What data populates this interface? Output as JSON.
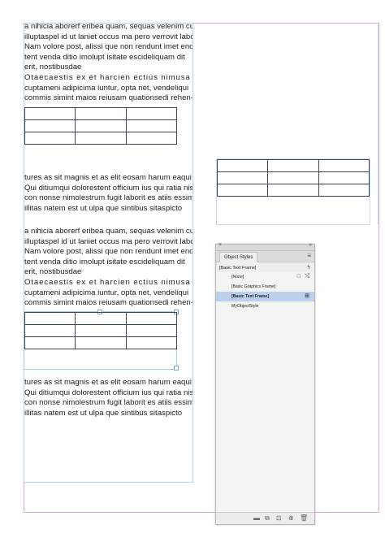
{
  "body_text": {
    "para1_lines": [
      "a nihicia aborerf eribea quam, sequas velenim cum",
      "illuptaspel id ut laniet occus ma pero verrovit labo.",
      "Nam volore post, alissi que non rendunt imet endio",
      "tent venda ditio imolupt isitate escideliquam dit",
      "erit, nostibusdae"
    ],
    "para2_lines": [
      "Otaecaestis ex et harcien ectius nimusa qui",
      "cuptameni adipicima iuntur, opta net, vendeliqui",
      "commis simint maios reiusam quationsedi rehen-"
    ],
    "para3_lines": [
      "tures as sit magnis et as elit eosam harum eaqui",
      "Qui ditiumqui dolorestent officium ius qui ratia nis",
      "con nonse nimolestrum fugit laborit es atiis essim",
      "illitas natem est ut ulpa que sintibus sitaspicto"
    ]
  },
  "tables": {
    "rows": 3,
    "cols": 3
  },
  "object_styles_panel": {
    "close_glyph": "×",
    "collapse_glyph": "»",
    "tab_label": "Object Styles",
    "menu_icon": "hamburger-menu-icon",
    "menu_glyph": "≡",
    "current_style": "[Basic Text Frame]",
    "quick_apply_glyph": "ϟ",
    "items": [
      {
        "label": "[None]"
      },
      {
        "label": "[Basic Graphics Frame]"
      },
      {
        "label": "[Basic Text Frame]"
      },
      {
        "label": "MyObjectStyle"
      }
    ],
    "none_icons": [
      "□",
      "⤭"
    ],
    "selected_icon": "⊞",
    "footer_icons": [
      {
        "name": "folder-icon",
        "glyph": "▬"
      },
      {
        "name": "clear-overrides-icon",
        "glyph": "⧉"
      },
      {
        "name": "clear-attributes-icon",
        "glyph": "⊡"
      },
      {
        "name": "new-style-icon",
        "glyph": "⊕"
      },
      {
        "name": "delete-icon",
        "glyph": "🗑"
      }
    ]
  },
  "colors": {
    "page_guide": "#d8a6d8",
    "column_guide": "#a9c9e6",
    "table_stroke": "#3b4656",
    "selected_row": "#bcd0ec"
  }
}
